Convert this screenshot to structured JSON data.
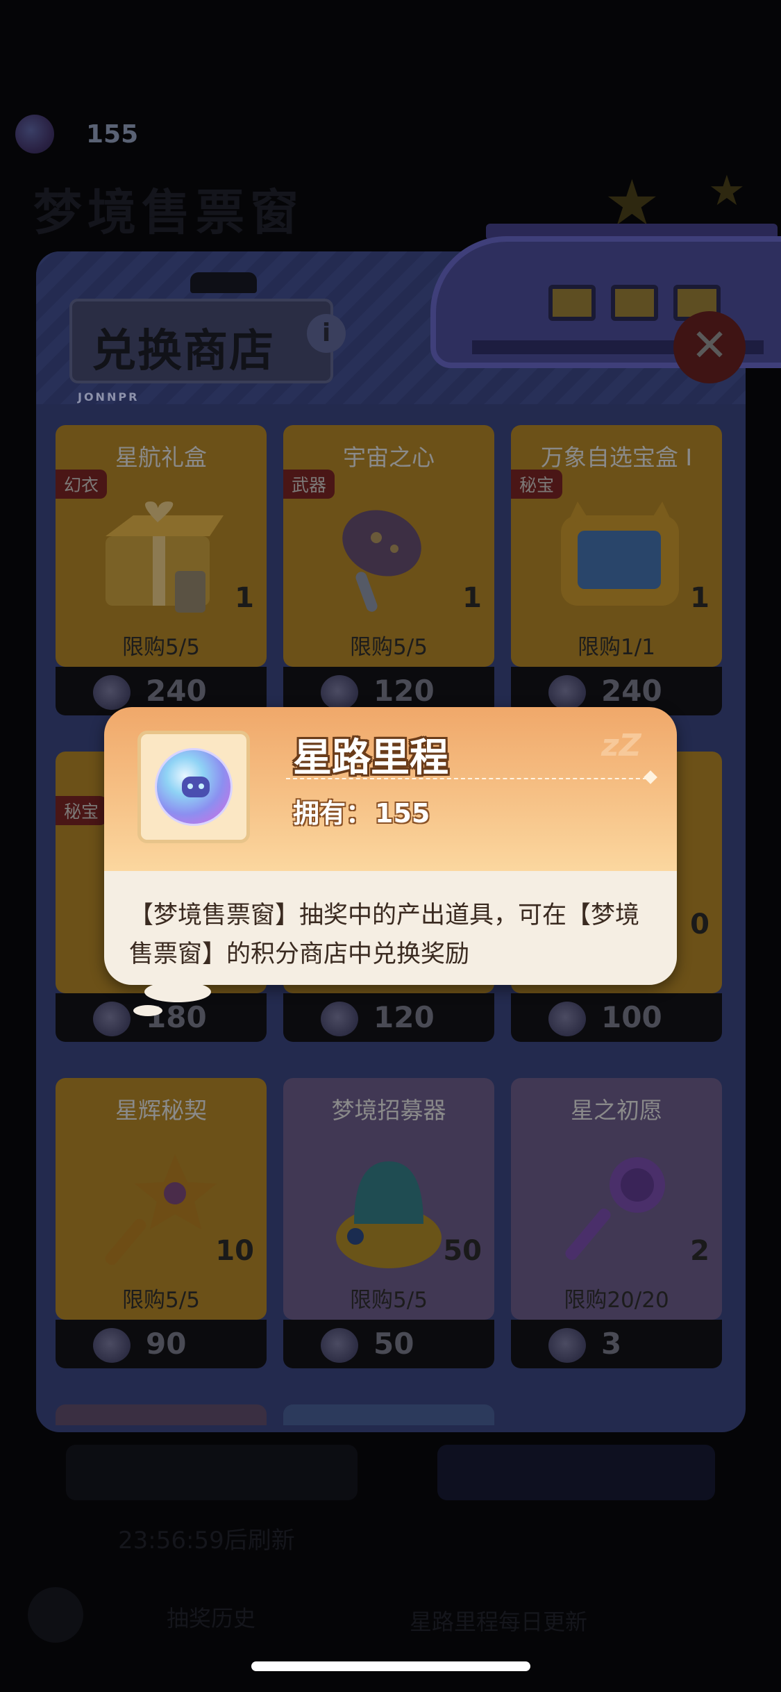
{
  "background": {
    "currency_value": "155",
    "page_title": "梦境售票窗",
    "bottom_text_1": "23:56:59后刷新",
    "bottom_text_2": "抽奖历史",
    "bottom_text_3": "星路里程每日更新"
  },
  "shop": {
    "title": "兑换商店",
    "info_icon": "i",
    "sign_tag": "JONNPR",
    "close_icon": "✕",
    "cards": [
      {
        "name": "星航礼盒",
        "tag": "幻衣",
        "qty": "1",
        "limit": "限购5/5",
        "price": "240",
        "style": "gold",
        "icon": "gift-box-icon"
      },
      {
        "name": "宇宙之心",
        "tag": "武器",
        "qty": "1",
        "limit": "限购5/5",
        "price": "120",
        "style": "gold",
        "icon": "star-racket-icon"
      },
      {
        "name": "万象自选宝盒 I",
        "tag": "秘宝",
        "qty": "1",
        "limit": "限购1/1",
        "price": "240",
        "style": "gold",
        "icon": "tv-box-icon"
      },
      {
        "name": "",
        "tag": "秘宝",
        "qty": "",
        "limit": "",
        "price": "180",
        "style": "gold",
        "icon": "hidden-item-icon"
      },
      {
        "name": "",
        "tag": "",
        "qty": "",
        "limit": "",
        "price": "120",
        "style": "gold",
        "icon": "hidden-item-icon"
      },
      {
        "name": "",
        "tag": "",
        "qty": "0",
        "limit": "",
        "price": "100",
        "style": "gold",
        "icon": "hidden-item-icon"
      },
      {
        "name": "星辉秘契",
        "tag": "",
        "qty": "10",
        "limit": "限购5/5",
        "price": "90",
        "style": "gold",
        "icon": "star-key-icon"
      },
      {
        "name": "梦境招募器",
        "tag": "",
        "qty": "50",
        "limit": "限购5/5",
        "price": "50",
        "style": "violet",
        "icon": "recruiter-icon"
      },
      {
        "name": "星之初愿",
        "tag": "",
        "qty": "2",
        "limit": "限购20/20",
        "price": "3",
        "style": "violet",
        "icon": "purple-key-icon"
      }
    ]
  },
  "popup": {
    "title": "星路里程",
    "owned_label": "拥有：",
    "owned_value": "155",
    "description": "【梦境售票窗】抽奖中的产出道具，可在【梦境售票窗】的积分商店中兑换奖励",
    "decoration": "zZ"
  },
  "colors": {
    "popup_header_top": "#f0a86a",
    "popup_header_bottom": "#fbd79f",
    "popup_body": "#f5eee3",
    "panel": "#232a4e"
  }
}
